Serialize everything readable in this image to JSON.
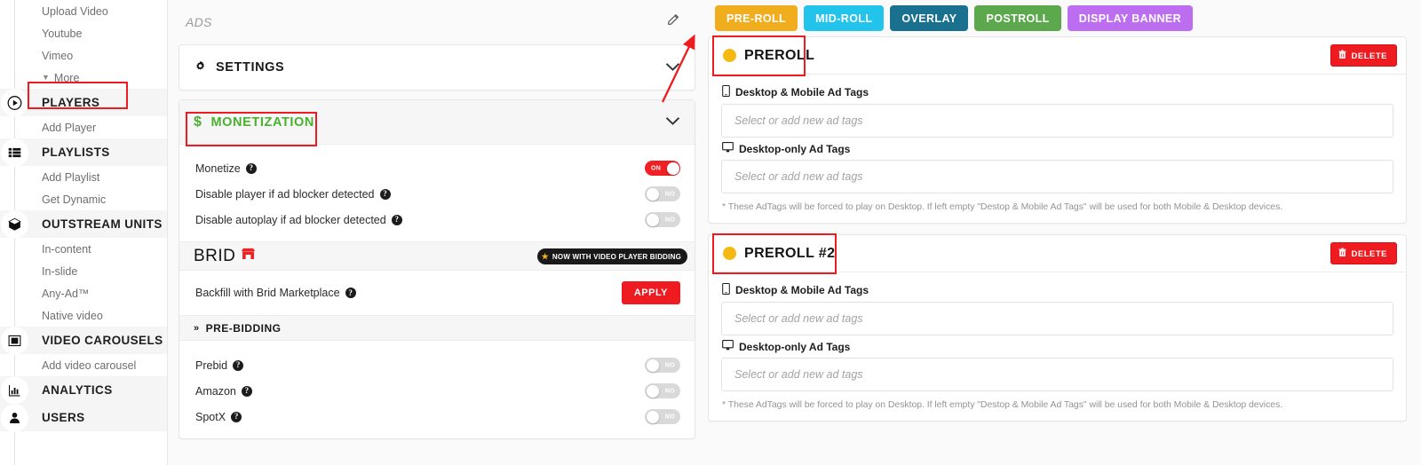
{
  "sidebar": {
    "items": [
      {
        "label": "Upload Video",
        "type": "sub",
        "icon": null
      },
      {
        "label": "Youtube",
        "type": "sub",
        "icon": null
      },
      {
        "label": "Vimeo",
        "type": "sub",
        "icon": null
      },
      {
        "label": "More",
        "type": "more",
        "icon": "caret-down-icon"
      },
      {
        "label": "PLAYERS",
        "type": "section",
        "icon": "play-circle-icon",
        "highlighted": true
      },
      {
        "label": "Add Player",
        "type": "sub",
        "icon": null
      },
      {
        "label": "PLAYLISTS",
        "type": "section",
        "icon": "list-icon"
      },
      {
        "label": "Add Playlist",
        "type": "sub",
        "icon": null
      },
      {
        "label": "Get Dynamic",
        "type": "sub",
        "icon": null
      },
      {
        "label": "OUTSTREAM UNITS",
        "type": "section",
        "icon": "cube-icon"
      },
      {
        "label": "In-content",
        "type": "sub",
        "icon": null
      },
      {
        "label": "In-slide",
        "type": "sub",
        "icon": null
      },
      {
        "label": "Any-Ad™",
        "type": "sub",
        "icon": null
      },
      {
        "label": "Native video",
        "type": "sub",
        "icon": null
      },
      {
        "label": "VIDEO CAROUSELS",
        "type": "section",
        "icon": "carousel-icon"
      },
      {
        "label": "Add video carousel",
        "type": "sub",
        "icon": null
      },
      {
        "label": "ANALYTICS",
        "type": "section",
        "icon": "bar-chart-icon"
      },
      {
        "label": "USERS",
        "type": "section",
        "icon": "user-icon"
      }
    ]
  },
  "main": {
    "ads_header": {
      "title": "ADS",
      "edit_icon": "pencil-icon"
    },
    "settings_card": {
      "title": "SETTINGS",
      "icon": "gear-icon",
      "chevron": "chevron-down-icon"
    },
    "monetization_card": {
      "title": "MONETIZATION",
      "icon": "dollar-icon",
      "chevron": "chevron-down-icon",
      "accent_color": "#49b02e",
      "options": [
        {
          "label": "Monetize",
          "help": "?",
          "toggle_state": "ON",
          "on": true
        },
        {
          "label": "Disable player if ad blocker detected",
          "help": "?",
          "toggle_state": "NO",
          "on": false
        },
        {
          "label": "Disable autoplay if ad blocker detected",
          "help": "?",
          "toggle_state": "NO",
          "on": false
        }
      ],
      "brid_bar": {
        "logo_text": "BRID",
        "logo_icon": "marketplace-store-icon",
        "badge_text": "NOW WITH VIDEO PLAYER BIDDING",
        "badge_icon": "star-icon"
      },
      "backfill": {
        "label": "Backfill with Brid Marketplace",
        "help": "?",
        "apply_label": "APPLY",
        "apply_color": "#ee1b20"
      },
      "prebidding": {
        "title": "PRE-BIDDING",
        "icon": "double-chevron-right-icon",
        "options": [
          {
            "label": "Prebid",
            "help": "?",
            "toggle_state": "NO",
            "on": false
          },
          {
            "label": "Amazon",
            "help": "?",
            "toggle_state": "NO",
            "on": false
          },
          {
            "label": "SpotX",
            "help": "?",
            "toggle_state": "NO",
            "on": false
          }
        ]
      }
    },
    "tabs": [
      {
        "label": "PRE-ROLL",
        "color": "#f0ad1e",
        "active": true
      },
      {
        "label": "MID-ROLL",
        "color": "#22c4ec",
        "active": false
      },
      {
        "label": "OVERLAY",
        "color": "#19708f",
        "active": false
      },
      {
        "label": "POSTROLL",
        "color": "#5ca84c",
        "active": false
      },
      {
        "label": "DISPLAY BANNER",
        "color": "#bd6ef0",
        "active": false
      }
    ],
    "roll_cards": [
      {
        "title": "PREROLL",
        "dot_color": "#f5b912",
        "delete_label": "DELETE",
        "delete_icon": "trash-icon",
        "highlighted": true,
        "fields": [
          {
            "label": "Desktop & Mobile Ad Tags",
            "icon": "mobile-icon",
            "placeholder": "Select or add new ad tags",
            "value": ""
          },
          {
            "label": "Desktop-only Ad Tags",
            "icon": "monitor-icon",
            "placeholder": "Select or add new ad tags",
            "value": ""
          }
        ],
        "note": "* These AdTags will be forced to play on Desktop. If left empty \"Destop & Mobile Ad Tags\" will be used for both Mobile & Desktop devices."
      },
      {
        "title": "PREROLL #2",
        "dot_color": "#f5b912",
        "delete_label": "DELETE",
        "delete_icon": "trash-icon",
        "highlighted": true,
        "fields": [
          {
            "label": "Desktop & Mobile Ad Tags",
            "icon": "mobile-icon",
            "placeholder": "Select or add new ad tags",
            "value": ""
          },
          {
            "label": "Desktop-only Ad Tags",
            "icon": "monitor-icon",
            "placeholder": "Select or add new ad tags",
            "value": ""
          }
        ],
        "note": "* These AdTags will be forced to play on Desktop. If left empty \"Destop & Mobile Ad Tags\" will be used for both Mobile & Desktop devices."
      }
    ],
    "annotations": {
      "highlight_color": "#ee1b20",
      "arrow_icon": "arrow-pointer"
    }
  }
}
